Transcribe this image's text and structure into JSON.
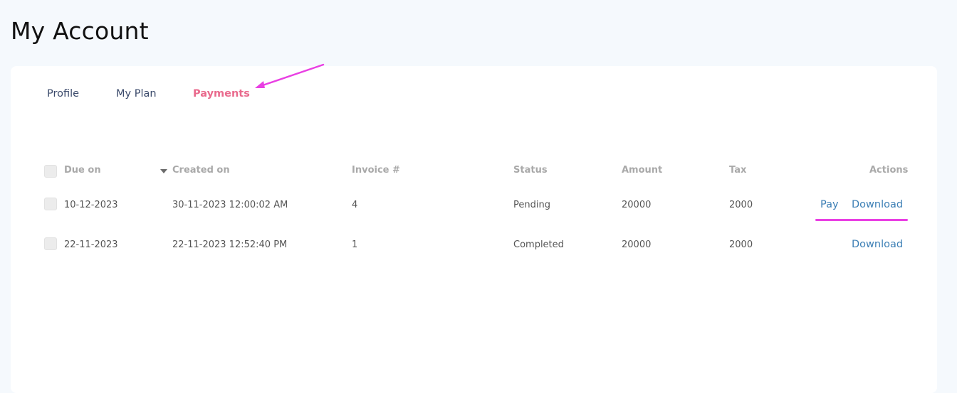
{
  "page": {
    "title": "My Account"
  },
  "tabs": [
    {
      "label": "Profile",
      "active": false
    },
    {
      "label": "My Plan",
      "active": false
    },
    {
      "label": "Payments",
      "active": true
    }
  ],
  "table": {
    "headers": {
      "due_on": "Due on",
      "created_on": "Created on",
      "invoice": "Invoice #",
      "status": "Status",
      "amount": "Amount",
      "tax": "Tax",
      "actions": "Actions"
    },
    "sort_icon": "caret-down-icon",
    "rows": [
      {
        "due_on": "10-12-2023",
        "created_on": "30-11-2023 12:00:02 AM",
        "invoice": "4",
        "status": "Pending",
        "amount": "20000",
        "tax": "2000",
        "pay_label": "Pay",
        "download_label": "Download"
      },
      {
        "due_on": "22-11-2023",
        "created_on": "22-11-2023 12:52:40 PM",
        "invoice": "1",
        "status": "Completed",
        "amount": "20000",
        "tax": "2000",
        "download_label": "Download"
      }
    ]
  },
  "colors": {
    "active_tab": "#e96a8d",
    "link": "#3c7fb5",
    "annotation": "#e940e3"
  }
}
